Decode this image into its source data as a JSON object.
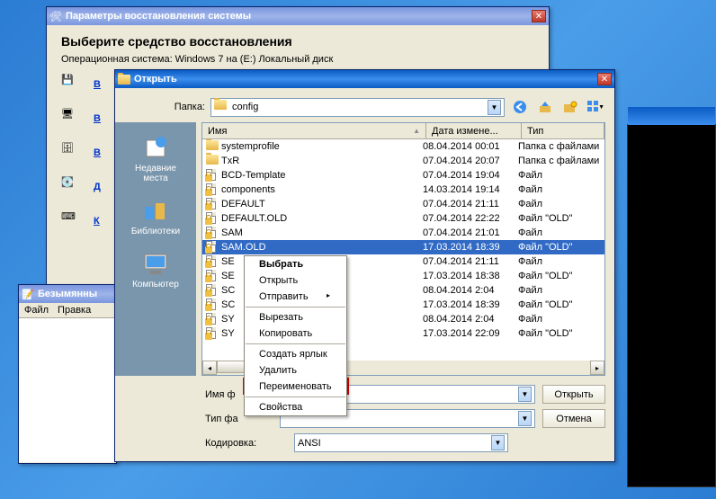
{
  "recovery": {
    "title": "Параметры восстановления системы",
    "heading": "Выберите средство восстановления",
    "sub": "Операционная система: Windows 7 на (E:) Локальный диск",
    "options": [
      "В",
      "В",
      "В",
      "Д",
      "К"
    ]
  },
  "notepad": {
    "title": "Безымянны",
    "menu": [
      "Файл",
      "Правка"
    ]
  },
  "open_dialog": {
    "title": "Открыть",
    "folder_label": "Папка:",
    "folder_name": "config",
    "columns": {
      "name": "Имя",
      "date": "Дата измене...",
      "type": "Тип"
    },
    "places": [
      {
        "name": "Недавние места"
      },
      {
        "name": "Библиотеки"
      },
      {
        "name": "Компьютер"
      }
    ],
    "rows": [
      {
        "icon": "folder",
        "name": "systemprofile",
        "date": "08.04.2014 00:01",
        "type": "Папка с файлами"
      },
      {
        "icon": "folder",
        "name": "TxR",
        "date": "07.04.2014 20:07",
        "type": "Папка с файлами"
      },
      {
        "icon": "file",
        "name": "BCD-Template",
        "date": "07.04.2014 19:04",
        "type": "Файл"
      },
      {
        "icon": "file",
        "name": "components",
        "date": "14.03.2014 19:14",
        "type": "Файл"
      },
      {
        "icon": "file",
        "name": "DEFAULT",
        "date": "07.04.2014 21:11",
        "type": "Файл"
      },
      {
        "icon": "file",
        "name": "DEFAULT.OLD",
        "date": "07.04.2014 22:22",
        "type": "Файл \"OLD\""
      },
      {
        "icon": "file",
        "name": "SAM",
        "date": "07.04.2014 21:01",
        "type": "Файл"
      },
      {
        "icon": "file",
        "name": "SAM.OLD",
        "date": "17.03.2014 18:39",
        "type": "Файл \"OLD\"",
        "selected": true
      },
      {
        "icon": "file",
        "name": "SE",
        "date": "07.04.2014 21:11",
        "type": "Файл"
      },
      {
        "icon": "file",
        "name": "SE",
        "date": "17.03.2014 18:38",
        "type": "Файл \"OLD\""
      },
      {
        "icon": "file",
        "name": "SC",
        "date": "08.04.2014 2:04",
        "type": "Файл"
      },
      {
        "icon": "file",
        "name": "SC",
        "date": "17.03.2014 18:39",
        "type": "Файл \"OLD\""
      },
      {
        "icon": "file",
        "name": "SY",
        "date": "08.04.2014 2:04",
        "type": "Файл"
      },
      {
        "icon": "file",
        "name": "SY",
        "date": "17.03.2014 22:09",
        "type": "Файл \"OLD\""
      }
    ],
    "filename_label": "Имя ф",
    "filetype_label": "Тип фа",
    "encoding_label": "Кодировка:",
    "encoding_value": "ANSI",
    "open_btn": "Открыть",
    "cancel_btn": "Отмена"
  },
  "context_menu": {
    "items": [
      {
        "label": "Выбрать",
        "bold": true
      },
      {
        "label": "Открыть"
      },
      {
        "label": "Отправить",
        "submenu": true
      },
      {
        "sep": true
      },
      {
        "label": "Вырезать"
      },
      {
        "label": "Копировать"
      },
      {
        "sep": true
      },
      {
        "label": "Создать ярлык"
      },
      {
        "label": "Удалить"
      },
      {
        "label": "Переименовать",
        "highlight": true
      },
      {
        "sep": true
      },
      {
        "label": "Свойства"
      }
    ]
  }
}
